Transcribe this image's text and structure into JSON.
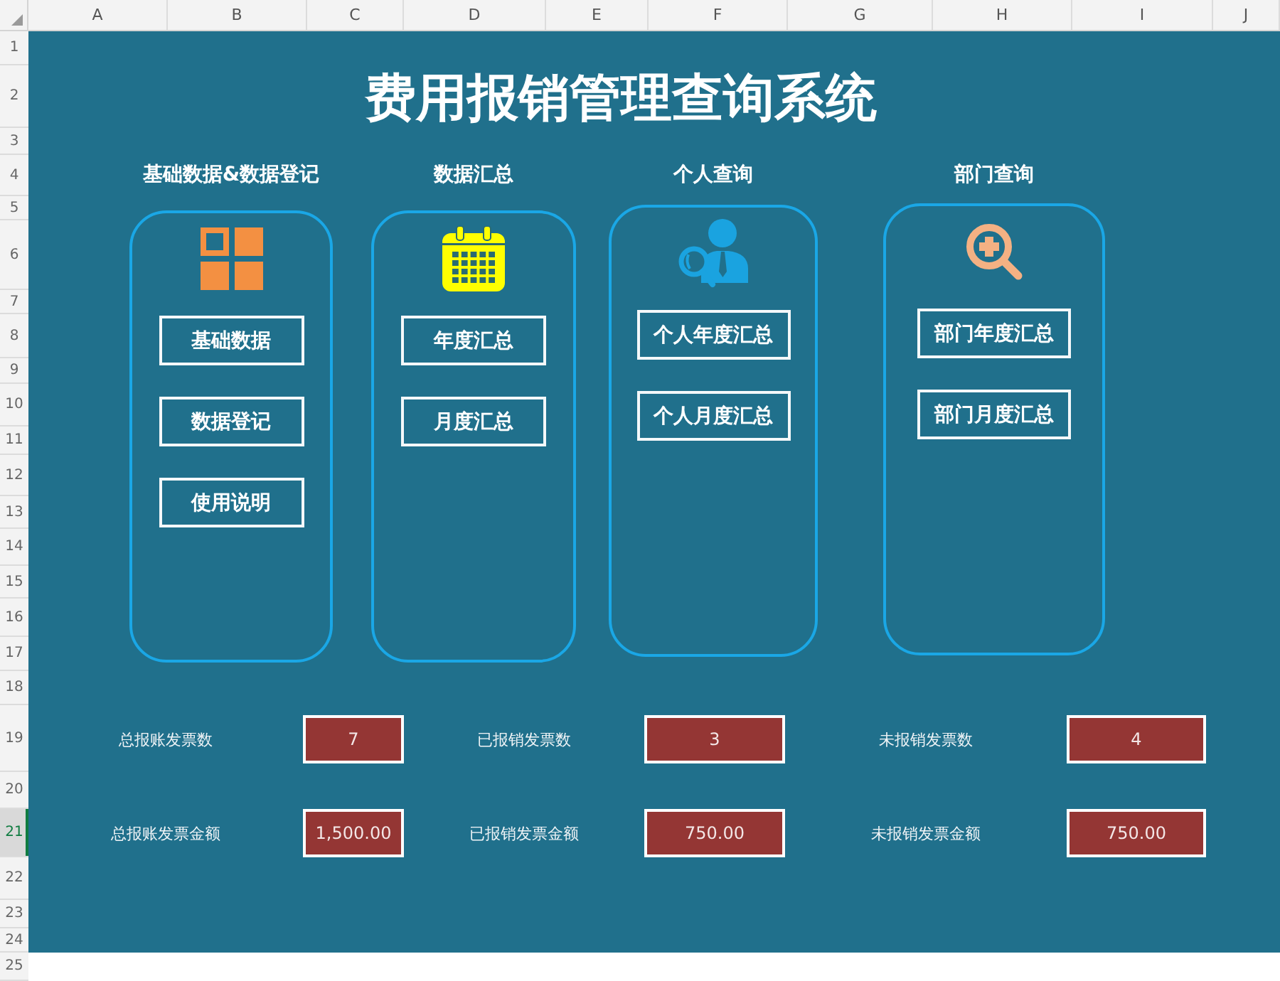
{
  "column_headers": [
    "A",
    "B",
    "C",
    "D",
    "E",
    "F",
    "G",
    "H",
    "I",
    "J"
  ],
  "row_headers": [
    {
      "label": "1",
      "selected": false
    },
    {
      "label": "2",
      "selected": false
    },
    {
      "label": "3",
      "selected": false
    },
    {
      "label": "4",
      "selected": false
    },
    {
      "label": "5",
      "selected": false
    },
    {
      "label": "6",
      "selected": false
    },
    {
      "label": "7",
      "selected": false
    },
    {
      "label": "8",
      "selected": false
    },
    {
      "label": "9",
      "selected": false
    },
    {
      "label": "10",
      "selected": false
    },
    {
      "label": "11",
      "selected": false
    },
    {
      "label": "12",
      "selected": false
    },
    {
      "label": "13",
      "selected": false
    },
    {
      "label": "14",
      "selected": false
    },
    {
      "label": "15",
      "selected": false
    },
    {
      "label": "16",
      "selected": false
    },
    {
      "label": "17",
      "selected": false
    },
    {
      "label": "18",
      "selected": false
    },
    {
      "label": "19",
      "selected": false
    },
    {
      "label": "20",
      "selected": false
    },
    {
      "label": "21",
      "selected": true
    },
    {
      "label": "22",
      "selected": false
    },
    {
      "label": "23",
      "selected": false
    },
    {
      "label": "24",
      "selected": false
    },
    {
      "label": "25",
      "selected": false
    }
  ],
  "title": "费用报销管理查询系统",
  "sections": [
    {
      "heading": "基础数据&数据登记",
      "kind": "tiles",
      "buttons": [
        "基础数据",
        "数据登记",
        "使用说明"
      ]
    },
    {
      "heading": "数据汇总",
      "kind": "calendar",
      "buttons": [
        "年度汇总",
        "月度汇总"
      ]
    },
    {
      "heading": "个人查询",
      "kind": "person",
      "buttons": [
        "个人年度汇总",
        "个人月度汇总"
      ]
    },
    {
      "heading": "部门查询",
      "kind": "magnifier",
      "buttons": [
        "部门年度汇总",
        "部门月度汇总"
      ]
    }
  ],
  "stats": [
    {
      "label": "总报账发票数",
      "value": "7"
    },
    {
      "label": "已报销发票数",
      "value": "3"
    },
    {
      "label": "未报销发票数",
      "value": "4"
    },
    {
      "label": "总报账发票金额",
      "value": "1,500.00"
    },
    {
      "label": "已报销发票金额",
      "value": "750.00"
    },
    {
      "label": "未报销发票金额",
      "value": "750.00"
    }
  ]
}
